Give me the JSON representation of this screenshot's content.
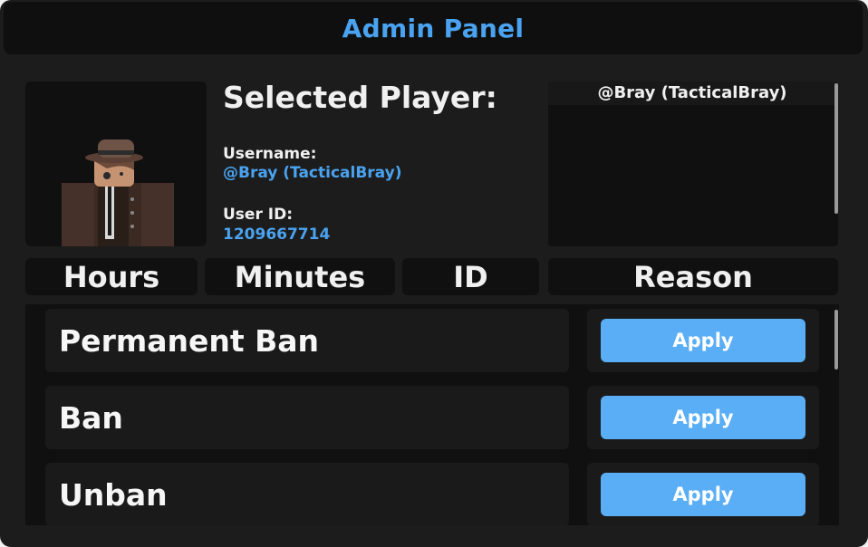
{
  "window": {
    "title": "Admin Panel"
  },
  "player": {
    "heading": "Selected Player:",
    "username_label": "Username:",
    "username_value": "@Bray (TacticalBray)",
    "userid_label": "User ID:",
    "userid_value": "1209667714"
  },
  "player_list": {
    "items": [
      "@Bray (TacticalBray)"
    ]
  },
  "fields": {
    "hours_placeholder": "Hours",
    "minutes_placeholder": "Minutes",
    "id_placeholder": "ID",
    "reason_placeholder": "Reason"
  },
  "actions": [
    {
      "label": "Permanent Ban",
      "button": "Apply"
    },
    {
      "label": "Ban",
      "button": "Apply"
    },
    {
      "label": "Unban",
      "button": "Apply"
    }
  ],
  "colors": {
    "accent": "#4aa3f0",
    "button": "#5aaef5",
    "panel_bg": "#1c1c1c",
    "inset_bg": "#101010"
  },
  "icons": {
    "avatar": "player-avatar-image"
  }
}
